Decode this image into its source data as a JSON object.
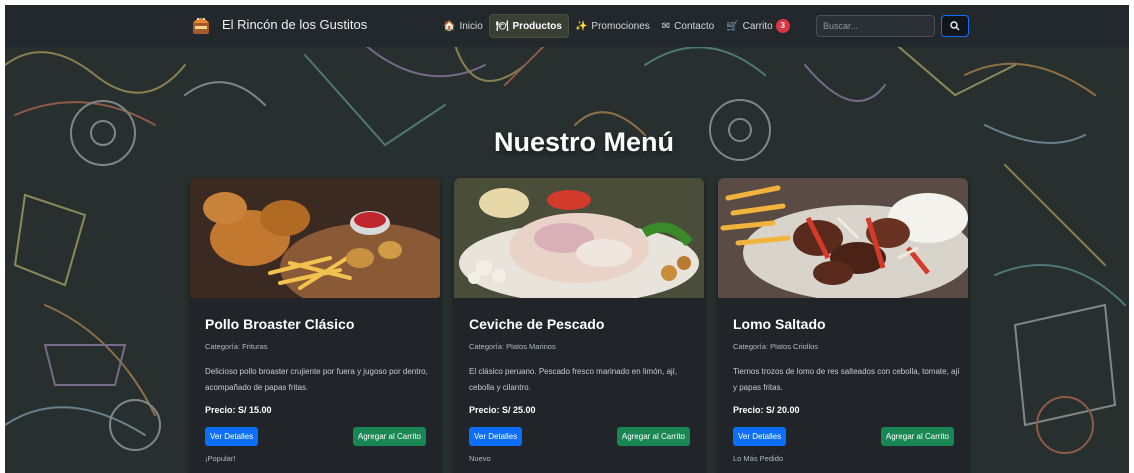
{
  "brand": {
    "name": "El Rincón de los Gustitos"
  },
  "nav": {
    "links": [
      {
        "icon": "house-icon",
        "glyph": "🏠",
        "label": "Inicio"
      },
      {
        "icon": "menu-icon",
        "glyph": "🍽",
        "label": "Productos",
        "active": true
      },
      {
        "icon": "sparkles-icon",
        "glyph": "✨",
        "label": "Promociones"
      },
      {
        "icon": "envelope-icon",
        "glyph": "✉",
        "label": "Contacto"
      },
      {
        "icon": "cart-icon",
        "glyph": "🛒",
        "label": "Carrito",
        "badge": "3"
      }
    ],
    "search_placeholder": "Buscar...",
    "search_button_icon": "search-icon"
  },
  "main": {
    "title": "Nuestro Menú"
  },
  "products": [
    {
      "name": "Pollo Broaster Clásico",
      "category": "Categoría: Frituras",
      "description": "Delicioso pollo broaster crujiente por fuera y jugoso por dentro, acompañado de papas fritas.",
      "price": "Precio: S/ 15.00",
      "details_label": "Ver Detalles",
      "cart_label": "Agregar al Carrito",
      "tag": "¡Popular!"
    },
    {
      "name": "Ceviche de Pescado",
      "category": "Categoría: Platos Marinos",
      "description": "El clásico peruano. Pescado fresco marinado en limón, ají, cebolla y cilantro.",
      "price": "Precio: S/ 25.00",
      "details_label": "Ver Detalles",
      "cart_label": "Agregar al Carrito",
      "tag": "Nuevo"
    },
    {
      "name": "Lomo Saltado",
      "category": "Categoría: Platos Criollos",
      "description": "Tiernos trozos de lomo de res salteados con cebolla, tomate, ají y papas fritas.",
      "price": "Precio: S/ 20.00",
      "details_label": "Ver Detalles",
      "cart_label": "Agregar al Carrito",
      "tag": "Lo Más Pedido"
    }
  ],
  "colors": {
    "navbar": "#23282d",
    "background": "#27302f",
    "card": "#212529",
    "primary": "#0d6efd",
    "success": "#198754",
    "danger": "#dc3545"
  }
}
